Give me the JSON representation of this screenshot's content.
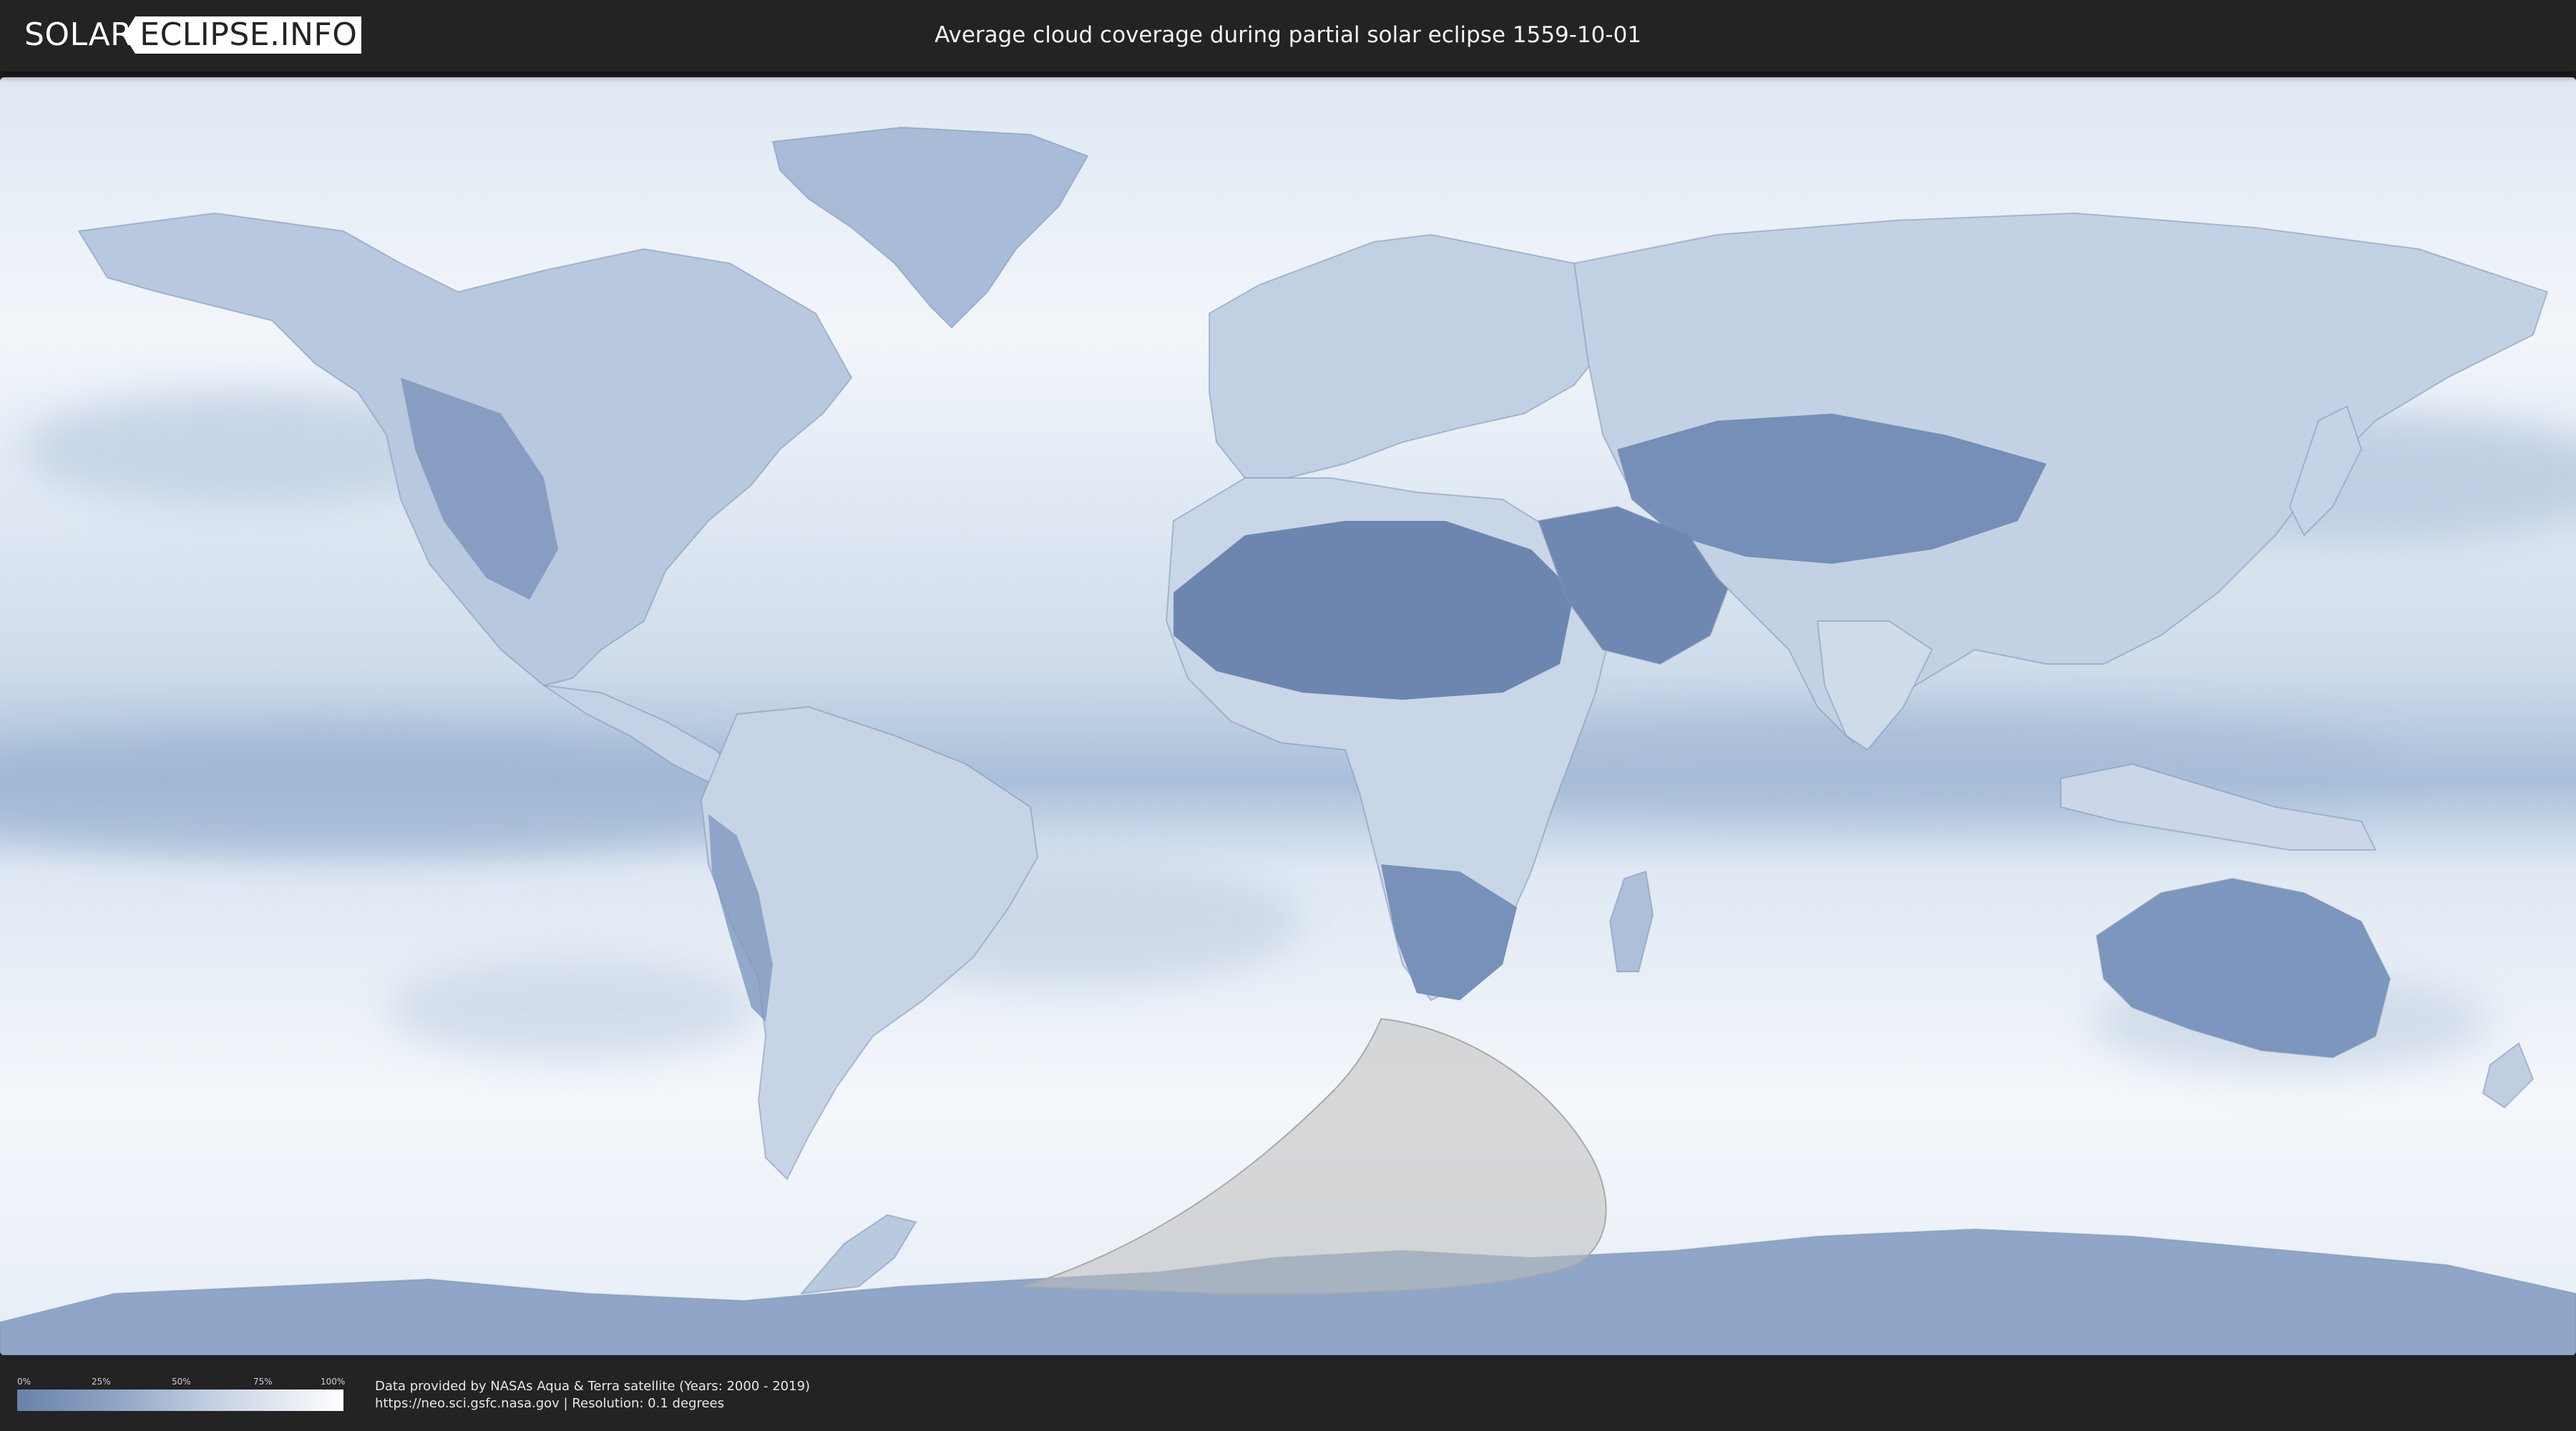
{
  "header": {
    "logo_left": "SOLAR",
    "logo_right": "ECLIPSE.INFO",
    "title": "Average cloud coverage during partial solar eclipse 1559-10-01"
  },
  "map": {
    "ocean_color": "#e9eff7",
    "land_cloudfree_color": "#6f88b1",
    "eclipse_zone_color": "#bdbdbd"
  },
  "legend": {
    "ticks": [
      "0%",
      "25%",
      "50%",
      "75%",
      "100%"
    ],
    "gradient_start": "#6a82ab",
    "gradient_end": "#ffffff"
  },
  "footer": {
    "credit_line1": "Data provided by NASAs Aqua & Terra satellite (Years: 2000 - 2019)",
    "credit_line2": "https://neo.sci.gsfc.nasa.gov | Resolution: 0.1 degrees"
  }
}
